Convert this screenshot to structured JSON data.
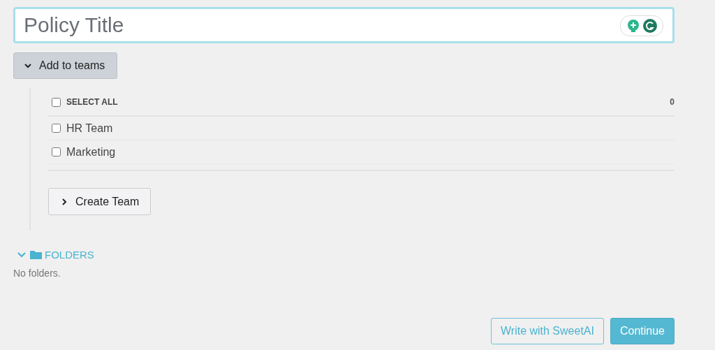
{
  "title_field": {
    "placeholder": "Policy Title"
  },
  "teams_toggle": {
    "label": "Add to teams",
    "expanded": true
  },
  "teams": {
    "select_all": {
      "label": "SELECT ALL",
      "checked": false,
      "count": "0"
    },
    "items": [
      {
        "label": "HR Team",
        "checked": false
      },
      {
        "label": "Marketing",
        "checked": false
      }
    ],
    "create_button": "Create Team"
  },
  "folders": {
    "label": "FOLDERS",
    "expanded": true,
    "empty_text": "No folders."
  },
  "buttons": [
    {
      "label": "Write with SweetAI",
      "kind": "outline"
    },
    {
      "label": "Continue",
      "kind": "primary"
    }
  ]
}
